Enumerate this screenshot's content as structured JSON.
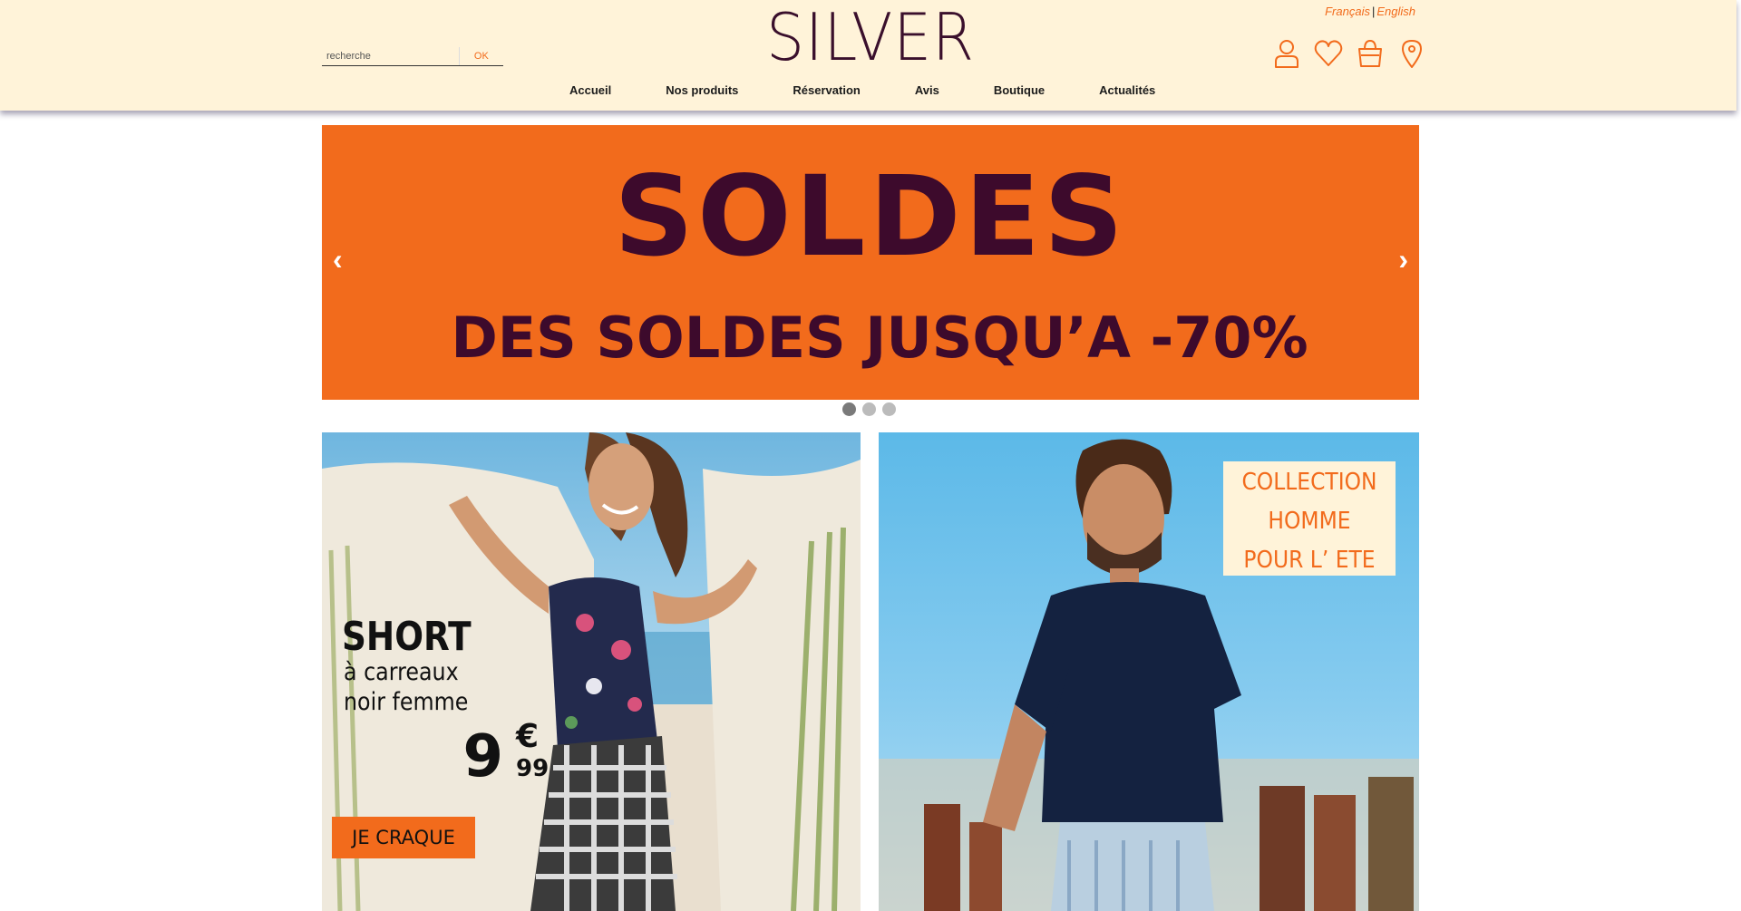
{
  "header": {
    "lang_fr": "Français",
    "lang_sep": "|",
    "lang_en": "English",
    "logo": "SILVER",
    "search": {
      "placeholder": "recherche",
      "button": "OK"
    },
    "icons": [
      "user-icon",
      "heart-icon",
      "basket-icon",
      "location-pin-icon"
    ],
    "nav": [
      "Accueil",
      "Nos produits",
      "Réservation",
      "Avis",
      "Boutique",
      "Actualités"
    ]
  },
  "hero": {
    "title": "SOLDES",
    "subtitle": "DES SOLDES JUSQU’A -70%",
    "prev": "‹",
    "next": "›",
    "slide_count": 3,
    "active_slide": 1
  },
  "promo_left": {
    "title": "SHORT",
    "subtitle_line1": "à carreaux",
    "subtitle_line2": "noir femme",
    "price_int": "9",
    "price_currency": "€",
    "price_cents": "99",
    "cta": "JE CRAQUE"
  },
  "promo_right": {
    "line1": "COLLECTION",
    "line2": "HOMME",
    "line3": "POUR L’ ETE"
  },
  "colors": {
    "header_bg": "#fff3d9",
    "accent": "#f26b1c",
    "brand_dark": "#3d0a2c"
  }
}
